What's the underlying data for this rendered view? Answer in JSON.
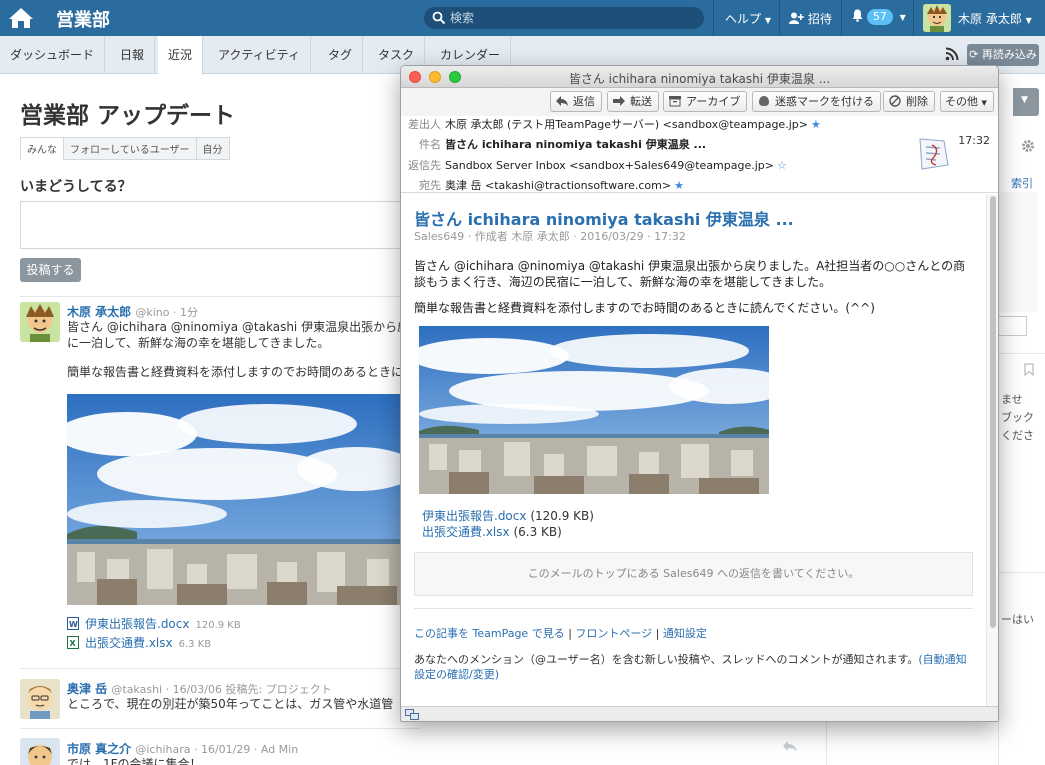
{
  "app": {
    "space_title": "営業部",
    "search_placeholder": "検索",
    "help_label": "ヘルプ",
    "invite_label": "招待",
    "notification_count": "57",
    "user_name": "木原 承太郎"
  },
  "nav": {
    "tabs": [
      "ダッシュボード",
      "日報",
      "近況",
      "アクティビティ",
      "タグ",
      "タスク",
      "カレンダー"
    ],
    "active_tab": "近況",
    "reload_label": "再読み込み"
  },
  "page": {
    "title": "営業部 アップデート",
    "filter_tabs": [
      "みんな",
      "フォローしているユーザー",
      "自分"
    ],
    "question": "いまどうしてる？",
    "post_button": "投稿する"
  },
  "feed": [
    {
      "name": "木原 承太郎",
      "meta": "@kino · 1分",
      "text_lines": [
        "皆さん @ichihara @ninomiya @takashi 伊東温泉出張から戻",
        "に一泊して、新鮮な海の幸を堪能してきました。",
        "",
        "簡単な報告書と経費資料を添付しますのでお時間のあるときに"
      ],
      "files": [
        {
          "name": "伊東出張報告.docx",
          "size": "120.9 KB"
        },
        {
          "name": "出張交通費.xlsx",
          "size": "6.3 KB"
        }
      ]
    },
    {
      "name": "奥津 岳",
      "meta": "@takashi · 16/03/06 投稿先: プロジェクト",
      "text": "ところで、現在の別荘が築50年ってことは、ガス管や水道管"
    },
    {
      "name": "市原 真之介",
      "meta": "@ichihara · 16/01/29 · Ad Min",
      "text": "では、1Fの会議に集合！"
    }
  ],
  "right_column": {
    "index_label": "索引",
    "fragments": [
      "ませ",
      "ブック",
      "くださ",
      "ーはい"
    ]
  },
  "mail": {
    "window_title": "皆さん ichihara ninomiya takashi 伊東温泉 ...",
    "toolbar": [
      "返信",
      "転送",
      "アーカイブ",
      "迷惑マークを付ける",
      "削除",
      "その他"
    ],
    "from_label": "差出人",
    "from": "木原 承太郎 (テスト用TeamPageサーバー) <sandbox@teampage.jp>",
    "subject_label": "件名",
    "subject": "皆さん ichihara ninomiya takashi 伊東温泉 ...",
    "reply_to_label": "返信先",
    "reply_to": "Sandbox Server Inbox <sandbox+Sales649@teampage.jp>",
    "to_label": "宛先",
    "to": "奥津 岳 <takashi@tractionsoftware.com>",
    "time": "17:32",
    "title": "皆さん ichihara ninomiya takashi 伊東温泉 ...",
    "meta": "Sales649 · 作成者 木原 承太郎 · 2016/03/29 · 17:32",
    "body_p1": "皆さん @ichihara @ninomiya @takashi 伊東温泉出張から戻りました。A社担当者の○○さんとの商談もうまく行き、海辺の民宿に一泊して、新鮮な海の幸を堪能してきました。",
    "body_p2": "簡単な報告書と経費資料を添付しますのでお時間のあるときに読んでください。(^^)",
    "files": [
      {
        "name": "伊東出張報告.docx",
        "size": "(120.9 KB)"
      },
      {
        "name": "出張交通費.xlsx",
        "size": "(6.3 KB)"
      }
    ],
    "reply_placeholder": "このメールのトップにある Sales649 への返信を書いてください。",
    "footer_link1": "この記事を TeamPage で見る",
    "footer_link2": "フロントページ",
    "footer_link3": "通知設定",
    "footer_note": "あなたへのメンション（@ユーザー名）を含む新しい投稿や、スレッドへのコメントが通知されます。",
    "footer_note_link": "(自動通知設定の確認/変更)"
  },
  "colors": {
    "topbar": "#2b6c9e",
    "link": "#2a6fb0",
    "badge": "#5bc0f8"
  }
}
